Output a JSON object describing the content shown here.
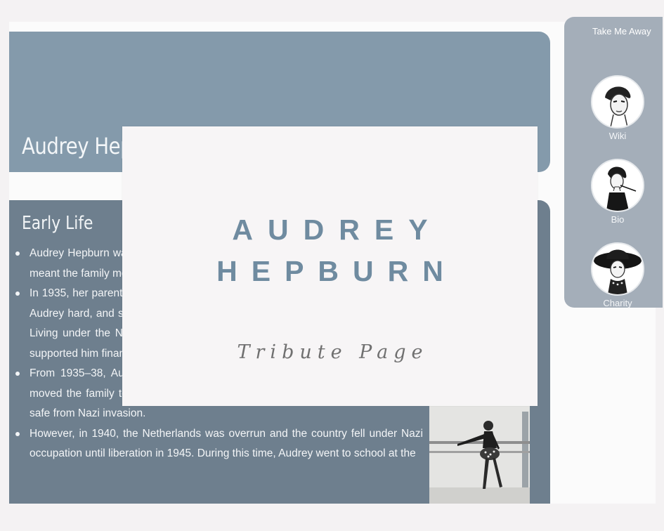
{
  "hero": {
    "title": "Audrey Hepburn"
  },
  "early_life": {
    "heading": "Early Life",
    "items": [
      "Audrey Hepburn was born in Brussels, Belgium, on 4 May 1929. Her father's job meant the family moved between England, Holland and Belgium.",
      "In 1935, her parents divorced; her father was a Nazi sympathiser. The divorce hit Audrey hard, and she would later say it was the most traumatic event of her life. Living under the Nazi occupation, she never saw her father again, though she supported him financially in later life.",
      "From 1935–38, Audrey went to boarding school in Kent; in 1939 her mother moved the family to Arnhem in the Netherlands, where she thought it would be safe from Nazi invasion.",
      "However, in 1940, the Netherlands was overrun and the country fell under Nazi occupation until liberation in 1945. During this time, Audrey went to school at the"
    ]
  },
  "sidebar": {
    "title": "Take Me Away",
    "links": [
      {
        "label": "Wiki",
        "icon": "audrey-portrait-icon"
      },
      {
        "label": "Bio",
        "icon": "audrey-cigarette-holder-icon"
      },
      {
        "label": "Charity",
        "icon": "audrey-hat-icon"
      }
    ]
  },
  "modal": {
    "title_line1": "AUDREY",
    "title_line2": "HEPBURN",
    "subtitle": "Tribute Page"
  },
  "colors": {
    "hero_bg": "#849aab",
    "content_bg": "#6e7f8e",
    "sidebar_bg": "#a4aeb9",
    "modal_bg": "#f7f5f6",
    "modal_title": "#6f8ba0",
    "modal_subtitle": "#707070"
  }
}
